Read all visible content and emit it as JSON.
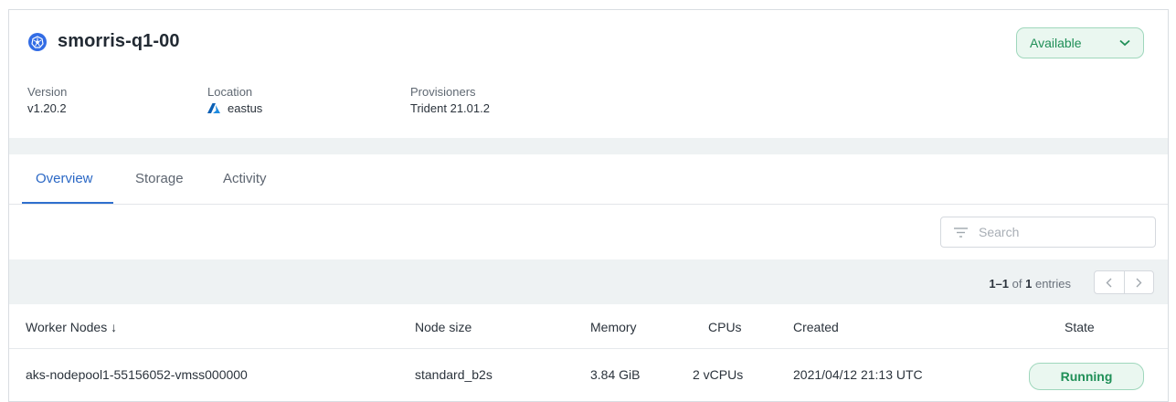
{
  "cluster": {
    "name": "smorris-q1-00",
    "status": "Available",
    "icon": "kubernetes-icon"
  },
  "meta": [
    {
      "label": "Version",
      "value": "v1.20.2"
    },
    {
      "label": "Location",
      "value": "eastus",
      "icon": "azure-icon"
    },
    {
      "label": "Provisioners",
      "value": "Trident 21.01.2"
    }
  ],
  "tabs": [
    {
      "label": "Overview",
      "active": true
    },
    {
      "label": "Storage",
      "active": false
    },
    {
      "label": "Activity",
      "active": false
    }
  ],
  "search": {
    "placeholder": "Search",
    "icon": "filter-icon"
  },
  "pagination": {
    "range": "1–1",
    "of_text": "of",
    "total": "1",
    "suffix": "entries"
  },
  "table": {
    "columns": [
      "Worker Nodes ↓",
      "Node size",
      "Memory",
      "CPUs",
      "Created",
      "State"
    ],
    "rows": [
      {
        "name": "aks-nodepool1-55156052-vmss000000",
        "size": "standard_b2s",
        "memory": "3.84 GiB",
        "cpus": "2 vCPUs",
        "created": "2021/04/12 21:13 UTC",
        "state": "Running"
      }
    ]
  },
  "colors": {
    "accent": "#2b68c5",
    "success": "#1f8f57",
    "success_bg": "#eaf7f0",
    "band": "#eef2f3"
  }
}
